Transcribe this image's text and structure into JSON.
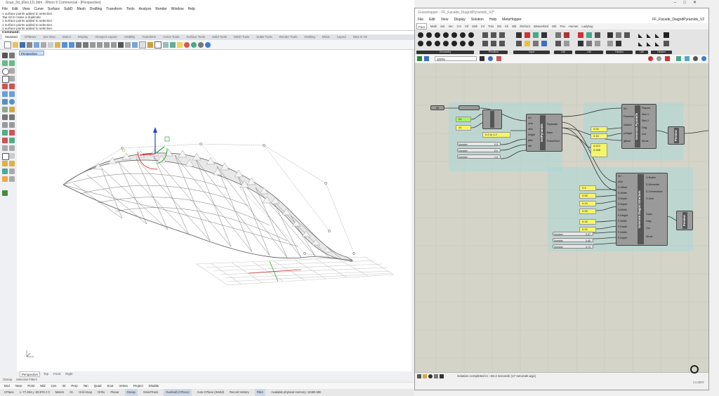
{
  "rhino": {
    "title": "Scan_3d_(Rev.12).3dm - Rhino 6 Commercial - [Perspective]",
    "menu": [
      "File",
      "Edit",
      "View",
      "Curve",
      "Surface",
      "SubD",
      "Mesh",
      "Drafting",
      "Transform",
      "Tools",
      "Analyze",
      "Render",
      "Window",
      "Help"
    ],
    "history": [
      "1 surface points added to selection.",
      "Tap Alt to make a duplicate",
      "1 surface points added to selection.",
      "1 surface points added to selection.",
      "1 surface points added to selection."
    ],
    "command_prompt": "Command:",
    "tabs": [
      "Standard",
      "CPlanes",
      "Set View",
      "Select",
      "Display",
      "Viewport Layout",
      "Visibility",
      "Transform",
      "Curve Tools",
      "Surface Tools",
      "Solid Tools",
      "Mesh Tools",
      "SubD Tools",
      "Render Tools",
      "Drafting",
      "Block",
      "Layout",
      "New in V6"
    ],
    "active_tab": "Standard",
    "viewport_label": "Perspective",
    "viewport_tabs": [
      "Perspective",
      "Top",
      "Front",
      "Right"
    ],
    "active_viewport": "Perspective",
    "osnap_tabs": [
      "OSnap",
      "Selection Filters"
    ],
    "osnap_items": [
      "End",
      "Near",
      "Point",
      "Mid",
      "Cen",
      "Int",
      "Perp",
      "Tan",
      "Quad",
      "Knot",
      "Vertex",
      "Project",
      "Disable"
    ],
    "status": {
      "cplane": "CPlane",
      "coords": "x -77.494  y -90.876  z 0",
      "units": "Meters",
      "layer": "01",
      "grid_snap": "Grid Snap",
      "ortho": "Ortho",
      "planar": "Planar",
      "osnap": "Osnap",
      "smarttrack": "SmartTrack",
      "gumball": "Gumball (CPlane)",
      "auto_cplane": "Auto CPlane (World)",
      "record_history": "Record History",
      "filter": "Filter",
      "memory": "Available physical memory: 16455 MB"
    }
  },
  "gh": {
    "title": "Grasshopper - FF_Facade_DiagridPyramids_V2*",
    "file_label": "FF_Facade_DiagridPyramids_V2",
    "menu": [
      "File",
      "Edit",
      "View",
      "Display",
      "Solution",
      "Help",
      "MetaHopper"
    ],
    "tabs": [
      "Para",
      "Math",
      "Set",
      "Vec",
      "Crv",
      "Srf",
      "Msh",
      "Int",
      "Trns",
      "Dis",
      "Kk",
      "Wb",
      "Elefront",
      "Weaverbird",
      "Wb",
      "Pan",
      "Human",
      "Ladybug"
    ],
    "active_tab": "Para",
    "groups": [
      "Geometry",
      "Primitive",
      "Input",
      "Util",
      "Util",
      "Hidden",
      "Util",
      "Hidden"
    ],
    "zoom": "100%",
    "status_message": "Solution completed in ~26.2 seconds (17 seconds ago)",
    "version": "1.0.0007",
    "canvas": {
      "srf_param": "Srf",
      "panels_left": [
        "24",
        "24",
        "0.2 to 1.2"
      ],
      "sliders_left": [
        {
          "label": "Number",
          "value": "0.5"
        },
        {
          "label": "Number",
          "value": "0.0"
        },
        {
          "label": "Number",
          "value": "1.0"
        }
      ],
      "panels_mid": [
        "0.04",
        "0.15",
        "0.212",
        "0.308"
      ],
      "panels_bottom": [
        "0.4",
        "0.06",
        "0.14",
        "0.08",
        "0.16",
        "0.24"
      ],
      "sliders_bottom": [
        {
          "label": "Number",
          "value": "0.37"
        },
        {
          "label": "Number",
          "value": "0.40"
        },
        {
          "label": "Number",
          "value": "0.73"
        }
      ],
      "comp_1": {
        "name": "GetPyramids",
        "inputs": [
          "Srf",
          "uDiv",
          "vDiv",
          "height",
          "jitter",
          "attr"
        ],
        "outputs": [
          "Pyramids",
          "Base",
          "FrameRect"
        ]
      },
      "comp_2": {
        "name": "Generate Pyramids",
        "inputs": [
          "Srf",
          "Pyramids",
          "uMatch",
          "pHeight",
          "gBase"
        ],
        "outputs": [
          "Frames",
          "Skin 1",
          "Skin 2",
          "Diag",
          "Out",
          "Struts"
        ]
      },
      "comp_3": {
        "name": "Generate Diagrid Structure",
        "inputs": [
          "Srf",
          "uDiv",
          "S-Offset",
          "S-Width",
          "S-Depth",
          "S-Depth",
          "S-Width",
          "F-Height",
          "F-Width",
          "F-Depth",
          "F-Width",
          "F-Depth"
        ],
        "outputs": [
          "S-Nodes",
          "S-Elements",
          "S-Connections",
          "S-Joint",
          "Gaps",
          "Diag",
          "Out",
          "Struts"
        ]
      },
      "out_1": "Preview",
      "out_2": "Preview"
    }
  }
}
